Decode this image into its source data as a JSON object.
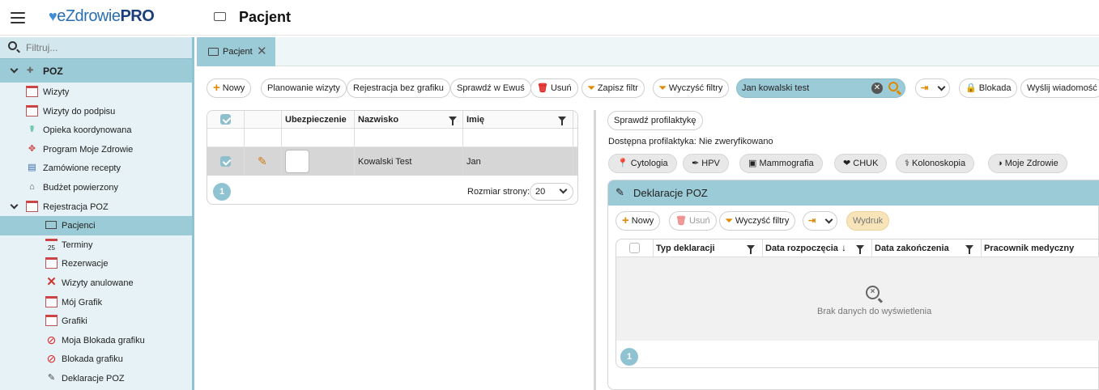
{
  "app": {
    "title": "Pacjent",
    "logo_prefix": "e",
    "logo_name": "Zdrowie",
    "logo_suffix": "PRO"
  },
  "sidebar": {
    "filter_placeholder": "Filtruj...",
    "section": "POZ",
    "items": [
      {
        "label": "Wizyty",
        "icon": "calendar-icon"
      },
      {
        "label": "Wizyty do podpisu",
        "icon": "calendar-icon"
      },
      {
        "label": "Opieka koordynowana",
        "icon": "care-icon"
      },
      {
        "label": "Program Moje Zdrowie",
        "icon": "program-icon"
      },
      {
        "label": "Zamówione recepty",
        "icon": "prescription-icon"
      },
      {
        "label": "Budżet powierzony",
        "icon": "budget-icon"
      }
    ],
    "group": {
      "label": "Rejestracja POZ",
      "icon": "registration-icon"
    },
    "sub_items": [
      {
        "label": "Pacjenci",
        "icon": "patient-card-icon",
        "active": true
      },
      {
        "label": "Terminy",
        "icon": "calendar-icon",
        "day": "25"
      },
      {
        "label": "Rezerwacje",
        "icon": "calendar-icon"
      },
      {
        "label": "Wizyty anulowane",
        "icon": "cancel-icon"
      },
      {
        "label": "Mój Grafik",
        "icon": "calendar-icon"
      },
      {
        "label": "Grafiki",
        "icon": "calendar-icon"
      },
      {
        "label": "Moja Blokada grafiku",
        "icon": "block-icon"
      },
      {
        "label": "Blokada grafiku",
        "icon": "block-icon"
      },
      {
        "label": "Deklaracje POZ",
        "icon": "declaration-icon"
      }
    ]
  },
  "tabs": [
    {
      "label": "Pacjent"
    }
  ],
  "toolbar": {
    "new": "Nowy",
    "plan": "Planowanie wizyty",
    "reg": "Rejestracja bez grafiku",
    "ewus": "Sprawdź w Ewuś",
    "delete": "Usuń",
    "save_filter": "Zapisz filtr",
    "clear_filters": "Wyczyść filtry",
    "search_value": "Jan kowalski test",
    "block": "Blokada",
    "send": "Wyślij wiadomość"
  },
  "grid": {
    "headers": {
      "insurance": "Ubezpieczenie",
      "surname": "Nazwisko",
      "name": "Imię"
    },
    "rows": [
      {
        "surname": "Kowalski Test",
        "name": "Jan"
      }
    ],
    "page": "1",
    "page_size_label": "Rozmiar strony:",
    "page_size": "20"
  },
  "right": {
    "check_btn": "Sprawdź profilaktykę",
    "available": "Dostępna profilaktyka: Nie zweryfikowano",
    "categories": [
      "Cytologia",
      "HPV",
      "Mammografia",
      "CHUK",
      "Kolonoskopia",
      "Moje Zdrowie"
    ]
  },
  "declarations": {
    "title": "Deklaracje POZ",
    "new": "Nowy",
    "delete": "Usuń",
    "clear": "Wyczyść filtry",
    "print": "Wydruk",
    "headers": {
      "type": "Typ deklaracji",
      "start": "Data rozpoczęcia",
      "end": "Data zakończenia",
      "staff": "Pracownik medyczny"
    },
    "empty": "Brak danych do wyświetlenia",
    "page": "1"
  },
  "colors": {
    "accent": "#9ccbd8",
    "orange": "#e08800",
    "sidebar_bg": "#e6f2f5"
  }
}
